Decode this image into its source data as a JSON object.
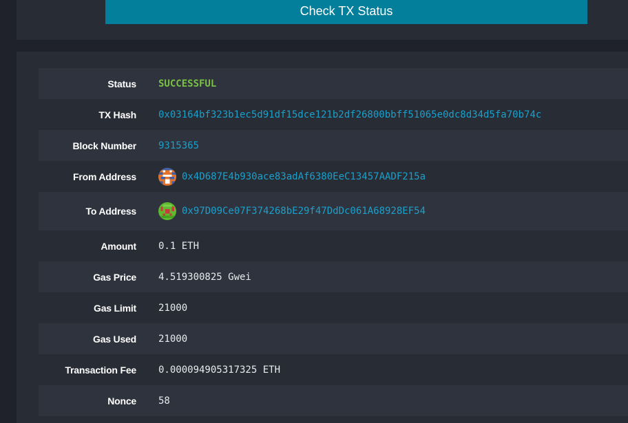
{
  "check_button": {
    "label": "Check TX Status"
  },
  "tx": {
    "status": {
      "label": "Status",
      "value": "SUCCESSFUL"
    },
    "hash": {
      "label": "TX Hash",
      "value": "0x03164bf323b1ec5d91df15dce121b2df26800bbff51065e0dc8d34d5fa70b74c"
    },
    "block": {
      "label": "Block Number",
      "value": "9315365"
    },
    "from": {
      "label": "From Address",
      "value": "0x4D687E4b930ace83adAf6380EeC13457AADF215a"
    },
    "to": {
      "label": "To Address",
      "value": "0x97D09Ce07F374268bE29f47DdDc061A68928EF54"
    },
    "amount": {
      "label": "Amount",
      "value": "0.1 ETH"
    },
    "gas_price": {
      "label": "Gas Price",
      "value": "4.519300825 Gwei"
    },
    "gas_limit": {
      "label": "Gas Limit",
      "value": "21000"
    },
    "gas_used": {
      "label": "Gas Used",
      "value": "21000"
    },
    "fee": {
      "label": "Transaction Fee",
      "value": "0.000094905317325 ETH"
    },
    "nonce": {
      "label": "Nonce",
      "value": "58"
    }
  },
  "colors": {
    "success": "#7ac044",
    "link": "#1ba0cc",
    "button": "#037f9b"
  },
  "icons": {
    "from_identicon": "from-address-identicon",
    "to_identicon": "to-address-identicon"
  }
}
